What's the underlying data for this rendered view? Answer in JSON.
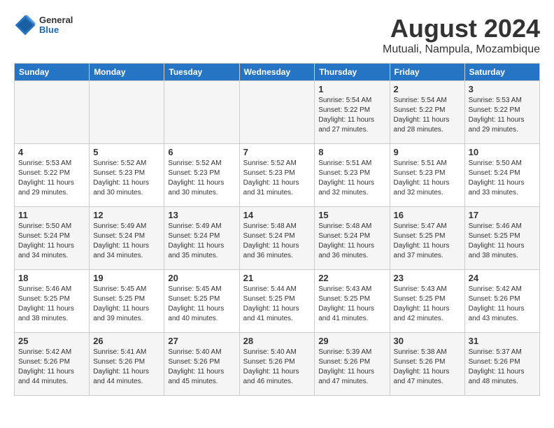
{
  "header": {
    "logo": {
      "general": "General",
      "blue": "Blue"
    },
    "title": "August 2024",
    "subtitle": "Mutuali, Nampula, Mozambique"
  },
  "days_of_week": [
    "Sunday",
    "Monday",
    "Tuesday",
    "Wednesday",
    "Thursday",
    "Friday",
    "Saturday"
  ],
  "weeks": [
    {
      "days": [
        {
          "number": "",
          "info": ""
        },
        {
          "number": "",
          "info": ""
        },
        {
          "number": "",
          "info": ""
        },
        {
          "number": "",
          "info": ""
        },
        {
          "number": "1",
          "sunrise": "Sunrise: 5:54 AM",
          "sunset": "Sunset: 5:22 PM",
          "daylight": "Daylight: 11 hours and 27 minutes."
        },
        {
          "number": "2",
          "sunrise": "Sunrise: 5:54 AM",
          "sunset": "Sunset: 5:22 PM",
          "daylight": "Daylight: 11 hours and 28 minutes."
        },
        {
          "number": "3",
          "sunrise": "Sunrise: 5:53 AM",
          "sunset": "Sunset: 5:22 PM",
          "daylight": "Daylight: 11 hours and 29 minutes."
        }
      ]
    },
    {
      "days": [
        {
          "number": "4",
          "sunrise": "Sunrise: 5:53 AM",
          "sunset": "Sunset: 5:22 PM",
          "daylight": "Daylight: 11 hours and 29 minutes."
        },
        {
          "number": "5",
          "sunrise": "Sunrise: 5:52 AM",
          "sunset": "Sunset: 5:23 PM",
          "daylight": "Daylight: 11 hours and 30 minutes."
        },
        {
          "number": "6",
          "sunrise": "Sunrise: 5:52 AM",
          "sunset": "Sunset: 5:23 PM",
          "daylight": "Daylight: 11 hours and 30 minutes."
        },
        {
          "number": "7",
          "sunrise": "Sunrise: 5:52 AM",
          "sunset": "Sunset: 5:23 PM",
          "daylight": "Daylight: 11 hours and 31 minutes."
        },
        {
          "number": "8",
          "sunrise": "Sunrise: 5:51 AM",
          "sunset": "Sunset: 5:23 PM",
          "daylight": "Daylight: 11 hours and 32 minutes."
        },
        {
          "number": "9",
          "sunrise": "Sunrise: 5:51 AM",
          "sunset": "Sunset: 5:23 PM",
          "daylight": "Daylight: 11 hours and 32 minutes."
        },
        {
          "number": "10",
          "sunrise": "Sunrise: 5:50 AM",
          "sunset": "Sunset: 5:24 PM",
          "daylight": "Daylight: 11 hours and 33 minutes."
        }
      ]
    },
    {
      "days": [
        {
          "number": "11",
          "sunrise": "Sunrise: 5:50 AM",
          "sunset": "Sunset: 5:24 PM",
          "daylight": "Daylight: 11 hours and 34 minutes."
        },
        {
          "number": "12",
          "sunrise": "Sunrise: 5:49 AM",
          "sunset": "Sunset: 5:24 PM",
          "daylight": "Daylight: 11 hours and 34 minutes."
        },
        {
          "number": "13",
          "sunrise": "Sunrise: 5:49 AM",
          "sunset": "Sunset: 5:24 PM",
          "daylight": "Daylight: 11 hours and 35 minutes."
        },
        {
          "number": "14",
          "sunrise": "Sunrise: 5:48 AM",
          "sunset": "Sunset: 5:24 PM",
          "daylight": "Daylight: 11 hours and 36 minutes."
        },
        {
          "number": "15",
          "sunrise": "Sunrise: 5:48 AM",
          "sunset": "Sunset: 5:24 PM",
          "daylight": "Daylight: 11 hours and 36 minutes."
        },
        {
          "number": "16",
          "sunrise": "Sunrise: 5:47 AM",
          "sunset": "Sunset: 5:25 PM",
          "daylight": "Daylight: 11 hours and 37 minutes."
        },
        {
          "number": "17",
          "sunrise": "Sunrise: 5:46 AM",
          "sunset": "Sunset: 5:25 PM",
          "daylight": "Daylight: 11 hours and 38 minutes."
        }
      ]
    },
    {
      "days": [
        {
          "number": "18",
          "sunrise": "Sunrise: 5:46 AM",
          "sunset": "Sunset: 5:25 PM",
          "daylight": "Daylight: 11 hours and 38 minutes."
        },
        {
          "number": "19",
          "sunrise": "Sunrise: 5:45 AM",
          "sunset": "Sunset: 5:25 PM",
          "daylight": "Daylight: 11 hours and 39 minutes."
        },
        {
          "number": "20",
          "sunrise": "Sunrise: 5:45 AM",
          "sunset": "Sunset: 5:25 PM",
          "daylight": "Daylight: 11 hours and 40 minutes."
        },
        {
          "number": "21",
          "sunrise": "Sunrise: 5:44 AM",
          "sunset": "Sunset: 5:25 PM",
          "daylight": "Daylight: 11 hours and 41 minutes."
        },
        {
          "number": "22",
          "sunrise": "Sunrise: 5:43 AM",
          "sunset": "Sunset: 5:25 PM",
          "daylight": "Daylight: 11 hours and 41 minutes."
        },
        {
          "number": "23",
          "sunrise": "Sunrise: 5:43 AM",
          "sunset": "Sunset: 5:25 PM",
          "daylight": "Daylight: 11 hours and 42 minutes."
        },
        {
          "number": "24",
          "sunrise": "Sunrise: 5:42 AM",
          "sunset": "Sunset: 5:26 PM",
          "daylight": "Daylight: 11 hours and 43 minutes."
        }
      ]
    },
    {
      "days": [
        {
          "number": "25",
          "sunrise": "Sunrise: 5:42 AM",
          "sunset": "Sunset: 5:26 PM",
          "daylight": "Daylight: 11 hours and 44 minutes."
        },
        {
          "number": "26",
          "sunrise": "Sunrise: 5:41 AM",
          "sunset": "Sunset: 5:26 PM",
          "daylight": "Daylight: 11 hours and 44 minutes."
        },
        {
          "number": "27",
          "sunrise": "Sunrise: 5:40 AM",
          "sunset": "Sunset: 5:26 PM",
          "daylight": "Daylight: 11 hours and 45 minutes."
        },
        {
          "number": "28",
          "sunrise": "Sunrise: 5:40 AM",
          "sunset": "Sunset: 5:26 PM",
          "daylight": "Daylight: 11 hours and 46 minutes."
        },
        {
          "number": "29",
          "sunrise": "Sunrise: 5:39 AM",
          "sunset": "Sunset: 5:26 PM",
          "daylight": "Daylight: 11 hours and 47 minutes."
        },
        {
          "number": "30",
          "sunrise": "Sunrise: 5:38 AM",
          "sunset": "Sunset: 5:26 PM",
          "daylight": "Daylight: 11 hours and 47 minutes."
        },
        {
          "number": "31",
          "sunrise": "Sunrise: 5:37 AM",
          "sunset": "Sunset: 5:26 PM",
          "daylight": "Daylight: 11 hours and 48 minutes."
        }
      ]
    }
  ]
}
